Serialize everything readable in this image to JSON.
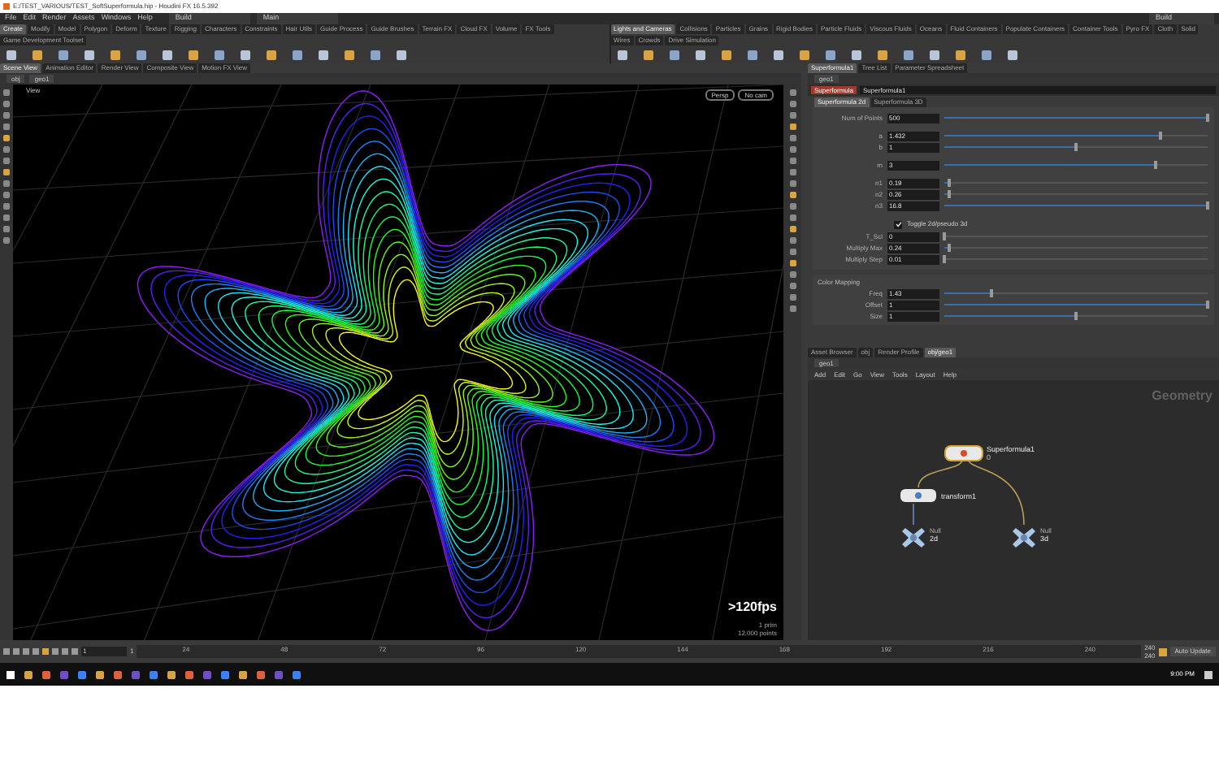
{
  "window": {
    "title": "E:/TEST_VARIOUS/TEST_SoftSuperformula.hip - Houdini FX 16.5.392"
  },
  "menu_bar": {
    "items": [
      "File",
      "Edit",
      "Render",
      "Assets",
      "Windows",
      "Help"
    ],
    "desktop": "Build",
    "workspace": "Main",
    "right_desktop": "Build"
  },
  "shelf_left": {
    "tabs": [
      {
        "label": "Create",
        "selected": true
      },
      {
        "label": "Modify",
        "selected": false
      },
      {
        "label": "Model",
        "selected": false
      },
      {
        "label": "Polygon",
        "selected": false
      },
      {
        "label": "Deform",
        "selected": false
      },
      {
        "label": "Texture",
        "selected": false
      },
      {
        "label": "Rigging",
        "selected": false
      },
      {
        "label": "Characters",
        "selected": false
      },
      {
        "label": "Constraints",
        "selected": false
      },
      {
        "label": "Hair Utils",
        "selected": false
      },
      {
        "label": "Guide Process",
        "selected": false
      },
      {
        "label": "Guide Brushes",
        "selected": false
      },
      {
        "label": "Terrain FX",
        "selected": false
      },
      {
        "label": "Cloud FX",
        "selected": false
      },
      {
        "label": "Volume",
        "selected": false
      },
      {
        "label": "FX Tools",
        "selected": false
      },
      {
        "label": "Game Development Toolset",
        "selected": false
      }
    ]
  },
  "shelf_right": {
    "tabs": [
      {
        "label": "Lights and Cameras",
        "selected": true
      },
      {
        "label": "Collisions",
        "selected": false
      },
      {
        "label": "Particles",
        "selected": false
      },
      {
        "label": "Grains",
        "selected": false
      },
      {
        "label": "Rigid Bodies",
        "selected": false
      },
      {
        "label": "Particle Fluids",
        "selected": false
      },
      {
        "label": "Viscous Fluids",
        "selected": false
      },
      {
        "label": "Oceans",
        "selected": false
      },
      {
        "label": "Fluid Containers",
        "selected": false
      },
      {
        "label": "Populate Containers",
        "selected": false
      },
      {
        "label": "Container Tools",
        "selected": false
      },
      {
        "label": "Pyro FX",
        "selected": false
      },
      {
        "label": "Cloth",
        "selected": false
      },
      {
        "label": "Solid",
        "selected": false
      },
      {
        "label": "Wires",
        "selected": false
      },
      {
        "label": "Crowds",
        "selected": false
      },
      {
        "label": "Drive Simulation",
        "selected": false
      }
    ]
  },
  "scene_view": {
    "tabs": [
      {
        "label": "Scene View",
        "selected": true
      },
      {
        "label": "Animation Editor",
        "selected": false
      },
      {
        "label": "Render View",
        "selected": false
      },
      {
        "label": "Composite View",
        "selected": false
      },
      {
        "label": "Motion FX View",
        "selected": false
      }
    ],
    "path": [
      "obj",
      "geo1"
    ],
    "view_label": "View",
    "display_buttons": [
      "Persp",
      "No cam"
    ],
    "fps": ">120fps",
    "stats": [
      "1 prim",
      "12,000 points"
    ]
  },
  "parameters": {
    "tabs": [
      {
        "label": "Superformula1",
        "selected": true
      },
      {
        "label": "Tree List",
        "selected": false
      },
      {
        "label": "Parameter Spreadsheet",
        "selected": false
      }
    ],
    "path": "geo1",
    "node_type": "Superformula",
    "node_name": "Superformula1",
    "sub_tabs": [
      {
        "label": "Superformula 2d",
        "selected": true
      },
      {
        "label": "Superformula 3D",
        "selected": false
      }
    ],
    "params": [
      {
        "kind": "slider",
        "label": "Num of Points",
        "value": "500",
        "level": 1
      },
      {
        "kind": "gap"
      },
      {
        "kind": "slider",
        "label": "a",
        "value": "1.432",
        "level": 0.82
      },
      {
        "kind": "slider",
        "label": "b",
        "value": "1",
        "level": 0.5
      },
      {
        "kind": "gap"
      },
      {
        "kind": "slider",
        "label": "m",
        "value": "3",
        "level": 0.8
      },
      {
        "kind": "gap"
      },
      {
        "kind": "slider",
        "label": "n1",
        "value": "0.19",
        "level": 0.02
      },
      {
        "kind": "slider",
        "label": "n2",
        "value": "0.26",
        "level": 0.02
      },
      {
        "kind": "slider",
        "label": "n3",
        "value": "16.8",
        "level": 1
      },
      {
        "kind": "gap"
      },
      {
        "kind": "toggle",
        "label": "Toggle 2d/pseudo 3d",
        "checked": true
      },
      {
        "kind": "slider",
        "label": "T_Scl",
        "value": "0",
        "level": 0
      },
      {
        "kind": "slider",
        "label": "Multiply Max",
        "value": "0.24",
        "level": 0.02
      },
      {
        "kind": "slider",
        "label": "Multiply Step",
        "value": "0.01",
        "level": 0
      }
    ],
    "color_mapping": {
      "title": "Color Mapping",
      "params": [
        {
          "kind": "slider",
          "label": "Freq",
          "value": "1.43",
          "level": 0.18
        },
        {
          "kind": "slider",
          "label": "Offset",
          "value": "1",
          "level": 1
        },
        {
          "kind": "slider",
          "label": "Size",
          "value": "1",
          "level": 0.5
        }
      ]
    }
  },
  "network": {
    "tabs": [
      {
        "label": "Asset Browser",
        "selected": false
      },
      {
        "label": "obj",
        "selected": false
      },
      {
        "label": "Render Profile",
        "selected": false
      },
      {
        "label": "obj/geo1",
        "selected": true
      }
    ],
    "path": "geo1",
    "menu": [
      "Add",
      "Edit",
      "Go",
      "View",
      "Tools",
      "Layout",
      "Help"
    ],
    "context": "Geometry",
    "nodes": [
      {
        "kind": "generator",
        "label": "Superformula1",
        "sublabel": "0",
        "selected": true
      },
      {
        "kind": "transform",
        "label": "transform1",
        "selected": false
      },
      {
        "kind": "null",
        "label": "2d",
        "tag": "Null",
        "selected": false
      },
      {
        "kind": "null",
        "label": "3d",
        "tag": "Null",
        "selected": false
      }
    ]
  },
  "timeline": {
    "frame": "1",
    "start": "1",
    "ticks": [
      "24",
      "48",
      "72",
      "96",
      "120",
      "144",
      "168",
      "192",
      "216",
      "240"
    ],
    "end": "240",
    "end_2": "240"
  },
  "taskbar": {
    "auto_update": "Auto Update",
    "time": "9:00 PM"
  }
}
